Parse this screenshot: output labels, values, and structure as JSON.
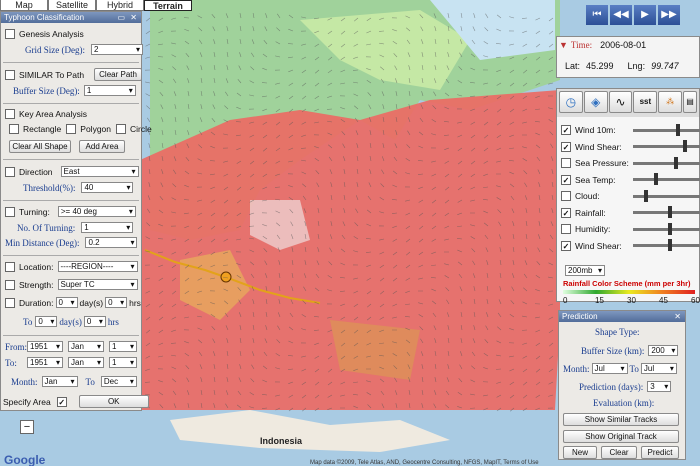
{
  "map_tabs": [
    "Map",
    "Satellite",
    "Hybrid",
    "Terrain"
  ],
  "selected_tab": "Terrain",
  "map_labels": {
    "country": "Indonesia",
    "attribution": "Map data ©2009, Tele Atlas, AND, Geocentre Consulting, NFGS, MapIT, Terms of Use",
    "logo": "Google"
  },
  "classification": {
    "title": "Typhoon Classification",
    "genesis": {
      "label": "Genesis Analysis",
      "grid_label": "Grid Size (Deg):",
      "grid_value": "2"
    },
    "similar": {
      "label": "SIMILAR To Path",
      "clear_path": "Clear Path",
      "buffer_label": "Buffer Size (Deg):",
      "buffer_value": "1"
    },
    "key_area": {
      "label": "Key Area Analysis",
      "rectangle": "Rectangle",
      "polygon": "Polygon",
      "circle": "Circle",
      "clear_all": "Clear All Shape",
      "add_area": "Add Area"
    },
    "direction": {
      "label": "Direction",
      "value": "East",
      "threshold_label": "Threshold(%):",
      "threshold_value": "40"
    },
    "turning": {
      "label": "Turning:",
      "value": ">= 40 deg",
      "no_label": "No. Of Turning:",
      "no_value": "1",
      "min_label": "Min Distance (Deg):",
      "min_value": "0.2"
    },
    "location": {
      "label": "Location:",
      "value": "----REGION----"
    },
    "strength": {
      "label": "Strength:",
      "value": "Super TC"
    },
    "duration": {
      "label": "Duration:",
      "from_days": "0",
      "days1": "day(s)",
      "from_hrs": "0",
      "hrs1": "hrs",
      "to_label": "To",
      "to_days": "0",
      "days2": "day(s)",
      "to_hrs": "0",
      "hrs2": "hrs"
    },
    "from": {
      "label": "From:",
      "year": "1951",
      "month": "Jan",
      "day": "1"
    },
    "to": {
      "label": "To:",
      "year": "1951",
      "month": "Jan",
      "day": "1"
    },
    "month": {
      "label": "Month:",
      "from": "Jan",
      "to_label": "To",
      "to": "Dec"
    },
    "specify_area": "Specify Area",
    "ok": "OK"
  },
  "info": {
    "time_label": "Time:",
    "time_value": "2006-08-01",
    "lat_label": "Lat:",
    "lat_value": "45.299",
    "lng_label": "Lng:",
    "lng_value": "99.747"
  },
  "layers": {
    "sst": "sst",
    "items": [
      {
        "label": "Wind 10m:",
        "checked": "✓",
        "value": "50",
        "pos": 0.62
      },
      {
        "label": "Wind Shear:",
        "checked": "✓",
        "value": "73",
        "pos": 0.72
      },
      {
        "label": "Sea Pressure:",
        "checked": "",
        "value": "59",
        "pos": 0.58
      },
      {
        "label": "Sea Temp:",
        "checked": "✓",
        "value": "30",
        "pos": 0.3
      },
      {
        "label": "Cloud:",
        "checked": "",
        "value": "18",
        "pos": 0.15
      },
      {
        "label": "Rainfall:",
        "checked": "✓",
        "value": "50",
        "pos": 0.5
      },
      {
        "label": "Humidity:",
        "checked": "",
        "value": "50",
        "pos": 0.5
      },
      {
        "label": "Wind Shear:",
        "checked": "✓",
        "value": "50",
        "pos": 0.5
      }
    ],
    "level": "200mb",
    "scheme_title": "Rainfall Color Scheme (mm per 3hr)",
    "scale": [
      "0",
      "15",
      "30",
      "45",
      "60"
    ]
  },
  "prediction": {
    "title": "Prediction",
    "shape_type": "Shape Type:",
    "buffer_label": "Buffer Size (km):",
    "buffer_value": "200",
    "month_label": "Month:",
    "month_from": "Jul",
    "to_label": "To",
    "month_to": "Jul",
    "days_label": "Prediction (days):",
    "days_value": "3",
    "eval_label": "Evaluation (km):",
    "show_similar": "Show Similar Tracks",
    "show_original": "Show Original Track",
    "new": "New",
    "clear": "Clear",
    "predict": "Predict"
  },
  "colors": {
    "rain_high": "#e8484a",
    "rain_mid": "#6fcf5b",
    "land": "#f0ebe0",
    "sea": "#a9cbe3",
    "panel_title": "#526d9a"
  }
}
